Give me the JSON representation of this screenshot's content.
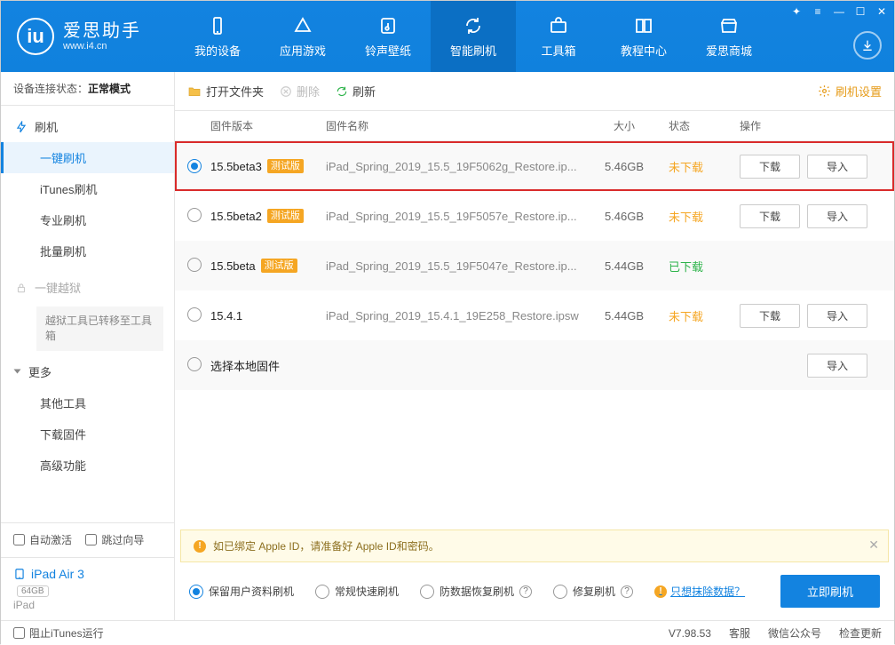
{
  "brand": {
    "name": "爱思助手",
    "url": "www.i4.cn"
  },
  "nav": [
    {
      "id": "device",
      "label": "我的设备"
    },
    {
      "id": "apps",
      "label": "应用游戏"
    },
    {
      "id": "ring",
      "label": "铃声壁纸"
    },
    {
      "id": "flash",
      "label": "智能刷机"
    },
    {
      "id": "toolbox",
      "label": "工具箱"
    },
    {
      "id": "tutor",
      "label": "教程中心"
    },
    {
      "id": "store",
      "label": "爱思商城"
    }
  ],
  "sidebar": {
    "status_label": "设备连接状态：",
    "status_value": "正常模式",
    "groups": {
      "flash_title": "刷机",
      "flash_items": [
        "一键刷机",
        "iTunes刷机",
        "专业刷机",
        "批量刷机"
      ],
      "jailbreak_title": "一键越狱",
      "jailbreak_note": "越狱工具已转移至工具箱",
      "more_title": "更多",
      "more_items": [
        "其他工具",
        "下载固件",
        "高级功能"
      ]
    },
    "auto_activate": "自动激活",
    "skip_guide": "跳过向导",
    "device": {
      "name": "iPad Air 3",
      "storage": "64GB",
      "type": "iPad"
    }
  },
  "toolbar": {
    "open": "打开文件夹",
    "delete": "删除",
    "refresh": "刷新",
    "settings": "刷机设置"
  },
  "columns": {
    "version": "固件版本",
    "name": "固件名称",
    "size": "大小",
    "status": "状态",
    "ops": "操作"
  },
  "rows": [
    {
      "selected": true,
      "version": "15.5beta3",
      "beta": "测试版",
      "name": "iPad_Spring_2019_15.5_19F5062g_Restore.ip...",
      "size": "5.46GB",
      "status": "未下载",
      "status_kind": "nd",
      "ops": [
        "下载",
        "导入"
      ],
      "hl": true
    },
    {
      "selected": false,
      "version": "15.5beta2",
      "beta": "测试版",
      "name": "iPad_Spring_2019_15.5_19F5057e_Restore.ip...",
      "size": "5.46GB",
      "status": "未下载",
      "status_kind": "nd",
      "ops": [
        "下载",
        "导入"
      ]
    },
    {
      "selected": false,
      "version": "15.5beta",
      "beta": "测试版",
      "name": "iPad_Spring_2019_15.5_19F5047e_Restore.ip...",
      "size": "5.44GB",
      "status": "已下载",
      "status_kind": "dl",
      "ops": []
    },
    {
      "selected": false,
      "version": "15.4.1",
      "beta": "",
      "name": "iPad_Spring_2019_15.4.1_19E258_Restore.ipsw",
      "size": "5.44GB",
      "status": "未下载",
      "status_kind": "nd",
      "ops": [
        "下载",
        "导入"
      ]
    },
    {
      "selected": false,
      "version": "选择本地固件",
      "beta": "",
      "name": "",
      "size": "",
      "status": "",
      "status_kind": "",
      "ops": [
        "导入"
      ]
    }
  ],
  "tip": "如已绑定 Apple ID，请准备好 Apple ID和密码。",
  "flash": {
    "opts": [
      "保留用户资料刷机",
      "常规快速刷机",
      "防数据恢复刷机",
      "修复刷机"
    ],
    "erase": "只想抹除数据？",
    "go": "立即刷机"
  },
  "statusbar": {
    "block": "阻止iTunes运行",
    "version": "V7.98.53",
    "links": [
      "客服",
      "微信公众号",
      "检查更新"
    ]
  }
}
